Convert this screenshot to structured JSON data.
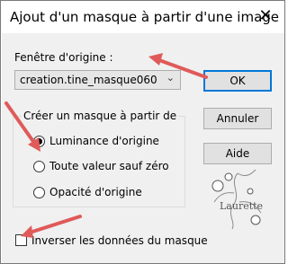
{
  "dialog": {
    "title": "Ajout d'un masque à partir d'une image",
    "close_glyph": "✕"
  },
  "source": {
    "label": "Fenêtre d'origine :",
    "selected": "creation.tine_masque060"
  },
  "group": {
    "legend": "Créer un masque à partir de",
    "options": [
      {
        "label": "Luminance d'origine",
        "selected": true
      },
      {
        "label": "Toute valeur sauf zéro",
        "selected": false
      },
      {
        "label": "Opacité d'origine",
        "selected": false
      }
    ]
  },
  "buttons": {
    "ok": "OK",
    "cancel": "Annuler",
    "help": "Aide"
  },
  "invert": {
    "label": "Inverser les données du masque",
    "checked": false
  },
  "watermark": {
    "text": "Laurette"
  },
  "colors": {
    "annotation_arrow": "#e05a5a",
    "default_button_border": "#0078d7"
  }
}
